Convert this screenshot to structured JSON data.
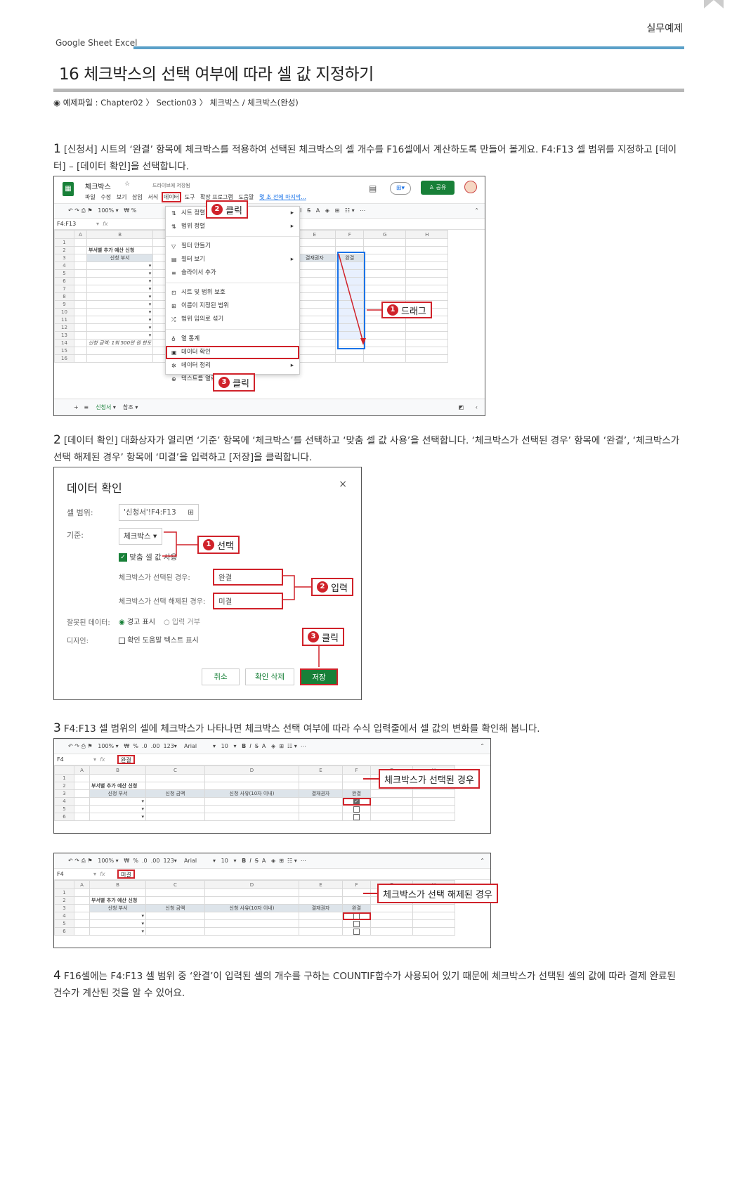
{
  "header": {
    "section": "실무예제",
    "brand": "Google Sheet  Excel"
  },
  "title": "16 체크박스의 선택 여부에 따라 셀 값 지정하기",
  "file_path": "예제파일 : Chapter02 〉 Section03 〉 체크박스 / 체크박스(완성)",
  "steps": [
    {
      "num": "1",
      "text": "[신청서] 시트의 ‘완결’ 항목에 체크박스를 적용하여 선택된 체크박스의 셀 개수를 F16셀에서 계산하도록 만들어 볼게요. F4:F13 셀 범위를 지정하고 [데이터] – [데이터 확인]을 선택합니다."
    },
    {
      "num": "2",
      "text": "[데이터 확인] 대화상자가 열리면 ‘기준’ 항목에 ‘체크박스’를 선택하고 ‘맞춤 셀 값 사용’을 선택합니다. ‘체크박스가 선택된 경우’ 항목에 ‘완결’, ‘체크박스가 선택 해제된 경우’ 항목에 ‘미결’을 입력하고 [저장]을 클릭합니다."
    },
    {
      "num": "3",
      "text": "F4:F13 셀 범위의 셀에 체크박스가 나타나면 체크박스 선택 여부에 따라 수식 입력줄에서 셀 값의 변화를 확인해 봅니다."
    },
    {
      "num": "4",
      "text": "F16셀에는 F4:F13 셀 범위 중 ‘완결’이 입력된 셀의 개수를 구하는 COUNTIF함수가 사용되어 있기 때문에 체크박스가 선택된 셀의 값에 따라 결제 완료된 건수가 계산된 것을 알 수 있어요."
    }
  ],
  "shot1": {
    "doc_title": "체크박스",
    "saved": "드라이브에 저장됨",
    "menus": [
      "파일",
      "수정",
      "보기",
      "삽입",
      "서식",
      "데이터",
      "도구",
      "확장 프로그램",
      "도움말"
    ],
    "last_edit": "몇 초 전에 마지막...",
    "share": "공유",
    "zoom": "100%",
    "namebox": "F4:F13",
    "cols": [
      "A",
      "B",
      "C",
      "D",
      "E",
      "F",
      "G",
      "H"
    ],
    "sheet_title": "부서별 추가 예산 신청",
    "h_dept": "신청 부서",
    "h_approver": "결재권자",
    "h_done": "완결",
    "note": "신청 금액: 1회 500만 원 한도",
    "tab": "신청서",
    "tab2": "참조",
    "menu_items": [
      "시트 정렬",
      "범위 정렬",
      "필터 만들기",
      "필터 보기",
      "슬라이서 추가",
      "시트 및 범위 보호",
      "이름이 지정된 범위",
      "범위 임의로 섞기",
      "열 통계",
      "데이터 확인",
      "데이터 정리",
      "텍스트를 열로 분할"
    ],
    "callout_drag": "드래그",
    "callout_click2": "클릭",
    "callout_click3": "클릭",
    "n1": "1",
    "n2": "2",
    "n3": "3"
  },
  "shot2": {
    "title": "데이터 확인",
    "l_range": "셀 범위:",
    "range": "'신청서'!F4:F13",
    "l_criteria": "기준:",
    "criteria": "체크박스",
    "custom": "맞춤 셀 값 사용",
    "l_checked": "체크박스가 선택된 경우:",
    "checked": "완결",
    "l_unchecked": "체크박스가 선택 해제된 경우:",
    "unchecked": "미결",
    "l_invalid": "잘못된 데이터:",
    "warn": "경고 표시",
    "reject": "입력 거부",
    "l_design": "디자인:",
    "helptext": "확인 도움말 텍스트 표시",
    "cancel": "취소",
    "remove": "확인 삭제",
    "save": "저장",
    "callout_select": "선택",
    "callout_input": "입력",
    "callout_click": "클릭",
    "n1": "1",
    "n2": "2",
    "n3": "3"
  },
  "shot3": {
    "zoom": "100%",
    "font": "Arial",
    "size": "10",
    "namebox": "F4",
    "value": "완결",
    "cols": [
      "A",
      "B",
      "C",
      "D",
      "E",
      "F",
      "G",
      "H"
    ],
    "sheet_title": "부서별 추가 예산 신청",
    "h_dept": "신청 부서",
    "h_amount": "신청 금액",
    "h_reason": "신청 사유(10자 이내)",
    "h_approver": "결재권자",
    "h_done": "완결",
    "callout": "체크박스가 선택된 경우"
  },
  "shot4": {
    "zoom": "100%",
    "font": "Arial",
    "size": "10",
    "namebox": "F4",
    "value": "미결",
    "cols": [
      "A",
      "B",
      "C",
      "D",
      "E",
      "F",
      "G",
      "H"
    ],
    "sheet_title": "부서별 추가 예산 신청",
    "h_dept": "신청 부서",
    "h_amount": "신청 금액",
    "h_reason": "신청 사유(10자 이내)",
    "h_approver": "결재권자",
    "h_done": "완결",
    "callout": "체크박스가 선택 해제된 경우"
  },
  "colors": {
    "accent_blue": "#5aa0c8",
    "callout_red": "#d0222a",
    "sheets_green": "#188038"
  }
}
